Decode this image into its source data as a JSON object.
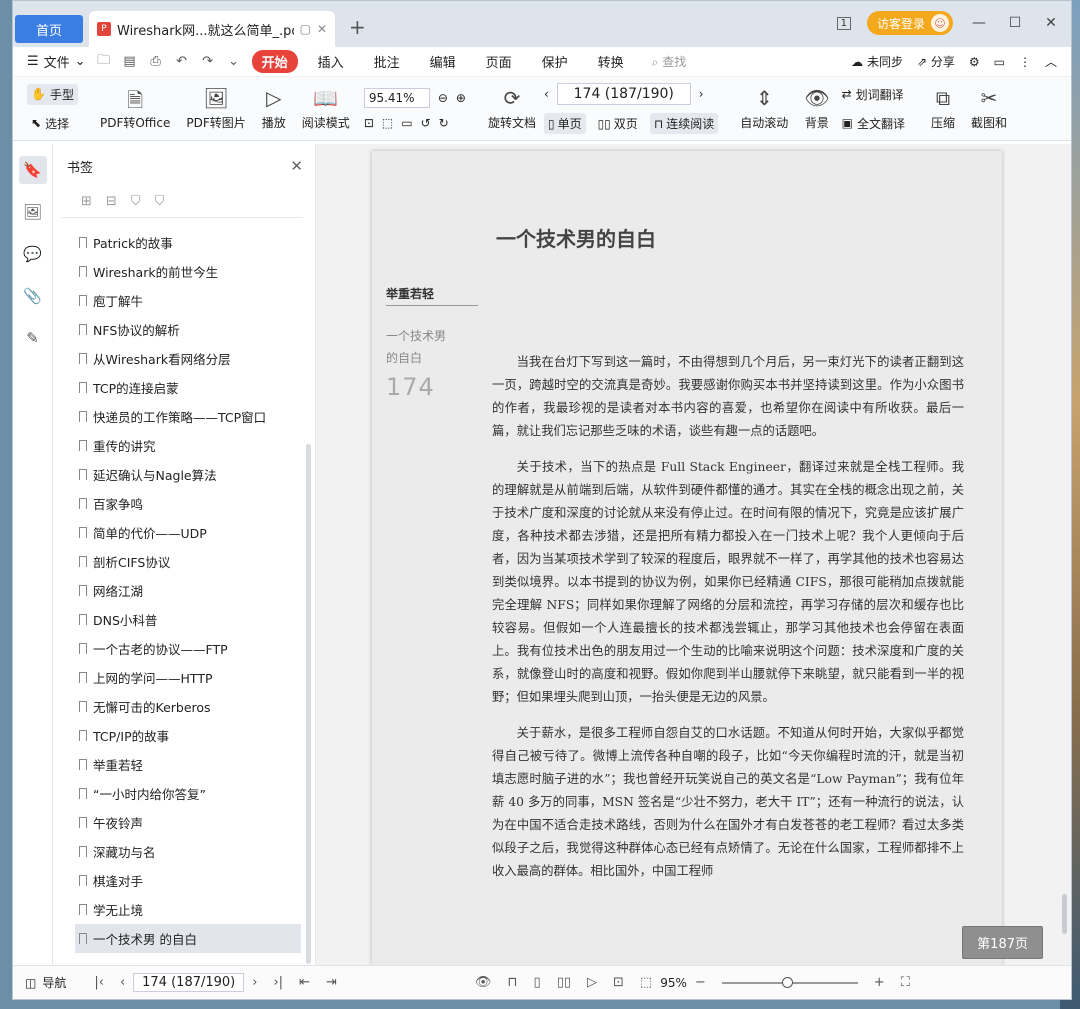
{
  "titlebar": {
    "home_tab": "首页",
    "doc_tab": "Wireshark网...就这么简单_.pdf",
    "badge": "1",
    "visitor_login": "访客登录"
  },
  "menu": {
    "file": "文件",
    "start": "开始",
    "items": [
      "插入",
      "批注",
      "编辑",
      "页面",
      "保护",
      "转换"
    ],
    "search": "查找",
    "unsynced": "未同步",
    "share": "分享"
  },
  "ribbon": {
    "hand": "手型",
    "select": "选择",
    "pdf_to_office": "PDF转Office",
    "pdf_to_image": "PDF转图片",
    "play": "播放",
    "read_mode": "阅读模式",
    "zoom": "95.41%",
    "page": "174 (187/190)",
    "rotate": "旋转文档",
    "single": "单页",
    "double": "双页",
    "continuous": "连续阅读",
    "auto_scroll": "自动滚动",
    "background": "背景",
    "word_translate": "划词翻译",
    "full_translate": "全文翻译",
    "compress": "压缩",
    "screenshot": "截图和"
  },
  "bookmarks": {
    "title": "书签",
    "items": [
      "Patrick的故事",
      "Wireshark的前世今生",
      "庖丁解牛",
      "NFS协议的解析",
      "从Wireshark看网络分层",
      "TCP的连接启蒙",
      "快递员的工作策略——TCP窗口",
      "重传的讲究",
      "延迟确认与Nagle算法",
      "百家争鸣",
      "简单的代价——UDP",
      "剖析CIFS协议",
      "网络江湖",
      "DNS小科普",
      "一个古老的协议——FTP",
      "上网的学问——HTTP",
      "无懈可击的Kerberos",
      "TCP/IP的故事",
      "举重若轻",
      "“一小时内给你答复”",
      "午夜铃声",
      "深藏功与名",
      "棋逢对手",
      "学无止境",
      "一个技术男 的自白"
    ]
  },
  "page": {
    "side_title": "举重若轻",
    "side_sub": "一个技术男的自白",
    "side_num": "174",
    "chapter": "一个技术男的自白",
    "paragraphs": [
      "当我在台灯下写到这一篇时，不由得想到几个月后，另一束灯光下的读者正翻到这一页，跨越时空的交流真是奇妙。我要感谢你购买本书并坚持读到这里。作为小众图书的作者，我最珍视的是读者对本书内容的喜爱，也希望你在阅读中有所收获。最后一篇，就让我们忘记那些乏味的术语，谈些有趣一点的话题吧。",
      "关于技术，当下的热点是 Full Stack Engineer，翻译过来就是全栈工程师。我的理解就是从前端到后端，从软件到硬件都懂的通才。其实在全栈的概念出现之前，关于技术广度和深度的讨论就从来没有停止过。在时间有限的情况下，究竟是应该扩展广度，各种技术都去涉猎，还是把所有精力都投入在一门技术上呢？我个人更倾向于后者，因为当某项技术学到了较深的程度后，眼界就不一样了，再学其他的技术也容易达到类似境界。以本书提到的协议为例，如果你已经精通 CIFS，那很可能稍加点拨就能完全理解 NFS；同样如果你理解了网络的分层和流控，再学习存储的层次和缓存也比较容易。但假如一个人连最擅长的技术都浅尝辄止，那学习其他技术也会停留在表面上。我有位技术出色的朋友用过一个生动的比喻来说明这个问题：技术深度和广度的关系，就像登山时的高度和视野。假如你爬到半山腰就停下来眺望，就只能看到一半的视野；但如果埋头爬到山顶，一抬头便是无边的风景。",
      "关于薪水，是很多工程师自怨自艾的口水话题。不知道从何时开始，大家似乎都觉得自己被亏待了。微博上流传各种自嘲的段子，比如“今天你编程时流的汗，就是当初填志愿时脑子进的水”；我也曾经开玩笑说自己的英文名是“Low Payman”；我有位年薪 40 多万的同事，MSN 签名是“少壮不努力，老大干 IT”；还有一种流行的说法，认为在中国不适合走技术路线，否则为什么在国外才有白发苍苍的老工程师？看过太多类似段子之后，我觉得这种群体心态已经有点矫情了。无论在什么国家，工程师都排不上收入最高的群体。相比国外，中国工程师"
    ],
    "page_badge": "第187页"
  },
  "status": {
    "nav": "导航",
    "page": "174 (187/190)",
    "zoom": "95%"
  }
}
